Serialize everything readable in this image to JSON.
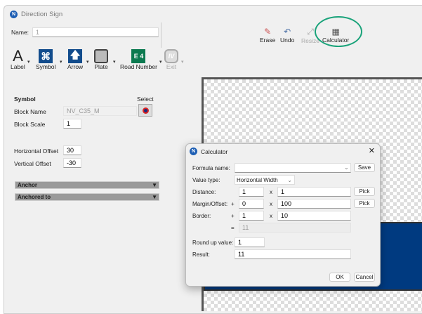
{
  "window": {
    "title": "Direction Sign"
  },
  "name": {
    "label": "Name:",
    "value": "1"
  },
  "tools": [
    {
      "label": "Label"
    },
    {
      "label": "Symbol"
    },
    {
      "label": "Arrow"
    },
    {
      "label": "Plate"
    },
    {
      "label": "Road Number",
      "icon_text": "E 4"
    },
    {
      "label": "Exit"
    }
  ],
  "actions": {
    "erase": "Erase",
    "undo": "Undo",
    "resize": "Resize",
    "calculator": "Calculator"
  },
  "highlight_color": "#1aa37a",
  "symbol": {
    "heading": "Symbol",
    "select": "Select",
    "block_name_label": "Block Name",
    "block_name": "NV_C35_M",
    "block_scale_label": "Block Scale",
    "block_scale": "1",
    "h_offset_label": "Horizontal Offset",
    "h_offset": "30",
    "v_offset_label": "Vertical Offset",
    "v_offset": "-30",
    "anchor": "Anchor",
    "anchored_to": "Anchored to"
  },
  "calc": {
    "title": "Calculator",
    "formula_label": "Formula name:",
    "formula": "",
    "save": "Save",
    "value_type_label": "Value type:",
    "value_type": "Horizontal Width",
    "distance_label": "Distance:",
    "distance_a": "1",
    "distance_b": "1",
    "pick": "Pick",
    "margin_label": "Margin/Offset:",
    "plus": "+",
    "margin_a": "0",
    "margin_b": "100",
    "border_label": "Border:",
    "border_a": "1",
    "border_b": "10",
    "times": "x",
    "equals": "=",
    "sum": "11",
    "round_label": "Round up value:",
    "round": "1",
    "result_label": "Result:",
    "result": "11",
    "ok": "OK",
    "cancel": "Cancel"
  }
}
